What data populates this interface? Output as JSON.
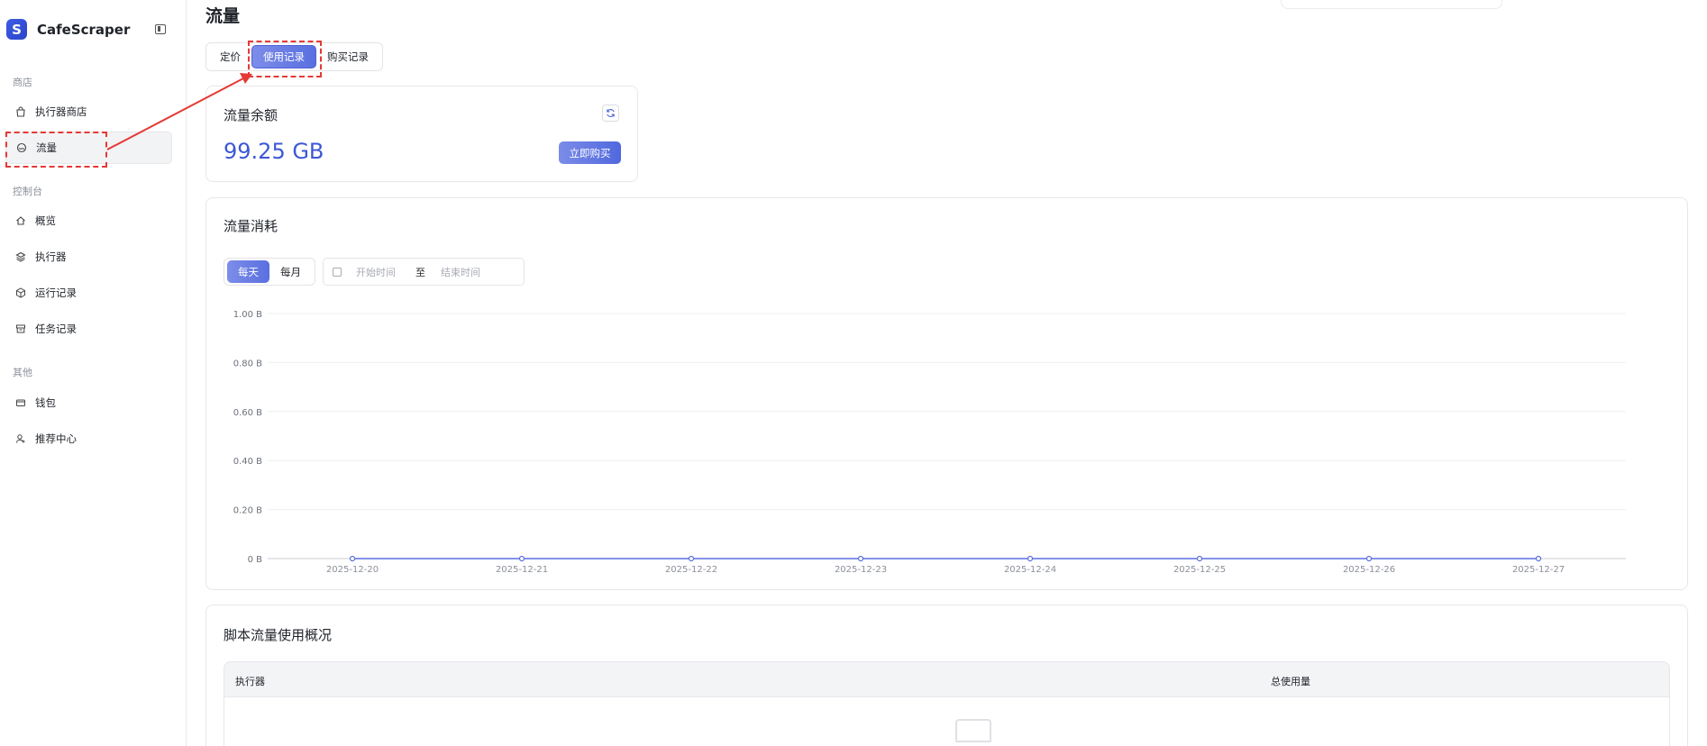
{
  "app": {
    "name": "CafeScraper"
  },
  "sidebar": {
    "sections": [
      {
        "label": "商店"
      },
      {
        "label": "控制台"
      },
      {
        "label": "其他"
      }
    ],
    "items": [
      {
        "label": "执行器商店",
        "icon": "shopping-bag-icon"
      },
      {
        "label": "流量",
        "icon": "traffic-icon",
        "active": true
      },
      {
        "label": "概览",
        "icon": "home-icon"
      },
      {
        "label": "执行器",
        "icon": "layers-icon"
      },
      {
        "label": "运行记录",
        "icon": "cube-icon"
      },
      {
        "label": "任务记录",
        "icon": "archive-icon"
      },
      {
        "label": "钱包",
        "icon": "wallet-icon"
      },
      {
        "label": "推荐中心",
        "icon": "user-plus-icon"
      }
    ]
  },
  "page": {
    "title": "流量"
  },
  "tabs": [
    {
      "label": "定价"
    },
    {
      "label": "使用记录",
      "active": true
    },
    {
      "label": "购买记录"
    }
  ],
  "balance": {
    "title": "流量余额",
    "value": "99.25 GB",
    "buy_label": "立即购买"
  },
  "usage": {
    "title": "流量消耗",
    "segments": [
      {
        "label": "每天",
        "active": true
      },
      {
        "label": "每月"
      }
    ],
    "range": {
      "start_placeholder": "开始时间",
      "separator": "至",
      "end_placeholder": "结束时间"
    }
  },
  "chart_data": {
    "type": "line",
    "x": [
      "2025-12-20",
      "2025-12-21",
      "2025-12-22",
      "2025-12-23",
      "2025-12-24",
      "2025-12-25",
      "2025-12-26",
      "2025-12-27"
    ],
    "series": [
      {
        "values": [
          0,
          0,
          0,
          0,
          0,
          0,
          0,
          0
        ]
      }
    ],
    "yticks": [
      "0 B",
      "0.20 B",
      "0.40 B",
      "0.60 B",
      "0.80 B",
      "1.00 B"
    ],
    "ylim": [
      0,
      1
    ],
    "grid": true,
    "color": "#5b6fe0"
  },
  "script_usage": {
    "title": "脚本流量使用概况",
    "columns": [
      "执行器",
      "总使用量"
    ]
  },
  "colors": {
    "accent": "#5068de",
    "annotation": "#e53935"
  }
}
